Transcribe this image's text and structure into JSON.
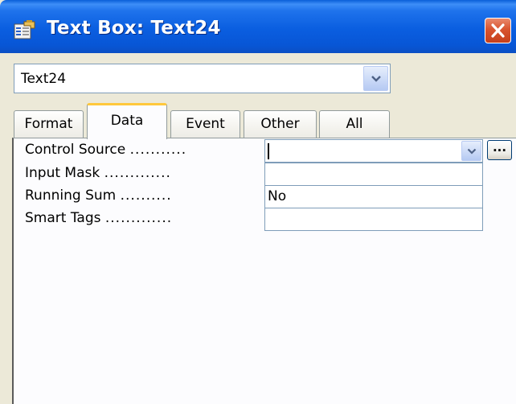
{
  "window": {
    "title": "Text Box: Text24",
    "close_label": "×"
  },
  "object_selector": {
    "value": "Text24"
  },
  "tabs": [
    {
      "label": "Format",
      "active": false
    },
    {
      "label": "Data",
      "active": true
    },
    {
      "label": "Event",
      "active": false
    },
    {
      "label": "Other",
      "active": false
    },
    {
      "label": "All",
      "active": false
    }
  ],
  "properties": [
    {
      "label": "Control Source",
      "dots": "...........",
      "value": "",
      "has_dropdown": true,
      "has_builder": true
    },
    {
      "label": "Input Mask",
      "dots": ".............",
      "value": ""
    },
    {
      "label": "Running Sum",
      "dots": "..........",
      "value": "No"
    },
    {
      "label": "Smart Tags",
      "dots": ".............",
      "value": ""
    }
  ],
  "builder_button_label": "..."
}
